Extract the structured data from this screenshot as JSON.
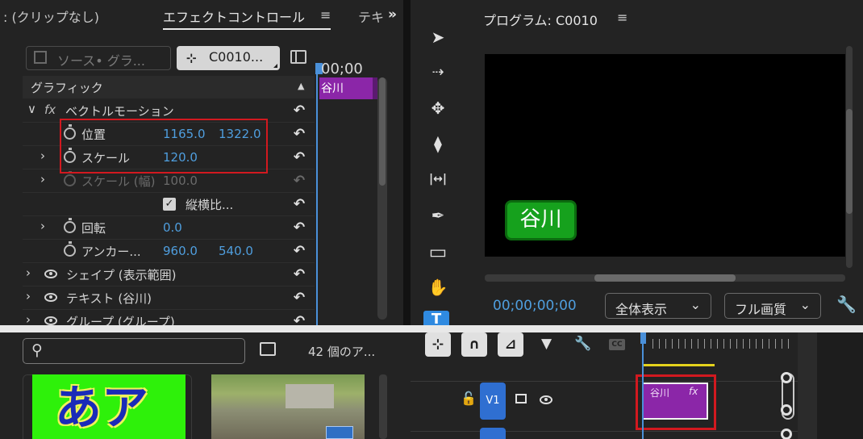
{
  "effect_controls": {
    "tabs": {
      "clip_mixer": ": (クリップなし)",
      "effect_controls": "エフェクトコントロール",
      "menu": "≡",
      "next_truncated": "テキ",
      "overflow": "»"
    },
    "source_selector": "ソース• グラ...",
    "clip_selector": "C0010...",
    "section_header": "グラフィック",
    "motion_group": "ベクトルモーション",
    "fx_label": "fx",
    "properties": [
      {
        "label": "位置",
        "value1": "1165.0",
        "value2": "1322.0"
      },
      {
        "label": "スケール",
        "value1": "120.0"
      },
      {
        "label": "スケール (幅)",
        "value1": "100.0"
      },
      {
        "label": "縦横比...",
        "checked": true
      },
      {
        "label": "回転",
        "value1": "0.0"
      },
      {
        "label": "アンカー...",
        "value1": "960.0",
        "value2": "540.0"
      }
    ],
    "layers": [
      {
        "label": "シェイプ (表示範囲)"
      },
      {
        "label": "テキスト (谷川)"
      },
      {
        "label": "グループ (グループ)"
      }
    ],
    "mini_timeline": {
      "timecode": "00;00",
      "clip_label": "谷川"
    }
  },
  "tools": [
    "selection-tool",
    "track-select-tool",
    "ripple-edit-tool",
    "razor-tool",
    "slip-tool",
    "pen-tool",
    "rectangle-tool",
    "hand-tool",
    "type-tool"
  ],
  "tool_glyphs": {
    "selection": "➤",
    "track_select": "⇢",
    "ripple": "✥",
    "razor": "⧫",
    "slip": "|↔|",
    "pen": "✒",
    "rect": "▭",
    "hand": "✋",
    "type": "T"
  },
  "program_monitor": {
    "title": "プログラム: C0010",
    "menu": "≡",
    "overlay_text": "谷川",
    "timecode": "00;00;00;00",
    "fit_dropdown": "全体表示",
    "quality_dropdown": "フル画質",
    "chevron": "⌄"
  },
  "project": {
    "search_placeholder": "",
    "item_count": "42 個のア...",
    "thumb1_text": "あア"
  },
  "timeline": {
    "track_label": "V1",
    "clip_label": "谷川",
    "clip_fx": "fx",
    "cc": "CC"
  },
  "colors": {
    "accent_blue": "#4f9ede",
    "clip_purple": "#8b26a8",
    "highlight_red": "#d2191f",
    "overlay_green": "#16a11d"
  }
}
